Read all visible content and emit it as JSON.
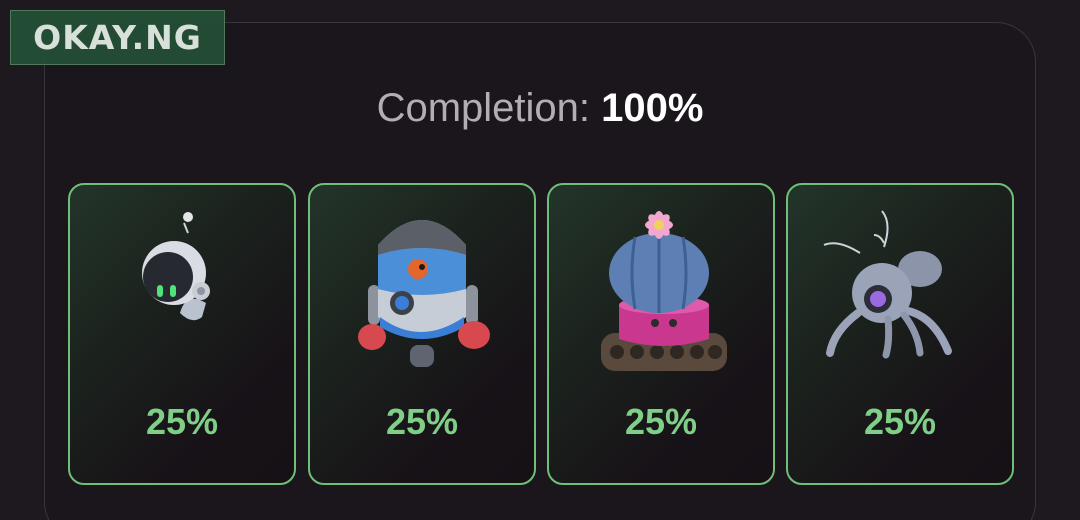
{
  "watermark": {
    "text": "OKAY.NG"
  },
  "completion": {
    "label": "Completion:",
    "value": "100%"
  },
  "cards": [
    {
      "icon": "astronaut-robot-icon",
      "percent": "25%"
    },
    {
      "icon": "boxer-fishbowl-robot-icon",
      "percent": "25%"
    },
    {
      "icon": "cactus-tank-robot-icon",
      "percent": "25%"
    },
    {
      "icon": "spider-bug-robot-icon",
      "percent": "25%"
    }
  ],
  "colors": {
    "background": "#1e191e",
    "card_border": "#6fbf7a",
    "percent_text": "#7fcf88",
    "completion_label": "#b3adb5",
    "completion_value": "#ffffff"
  }
}
